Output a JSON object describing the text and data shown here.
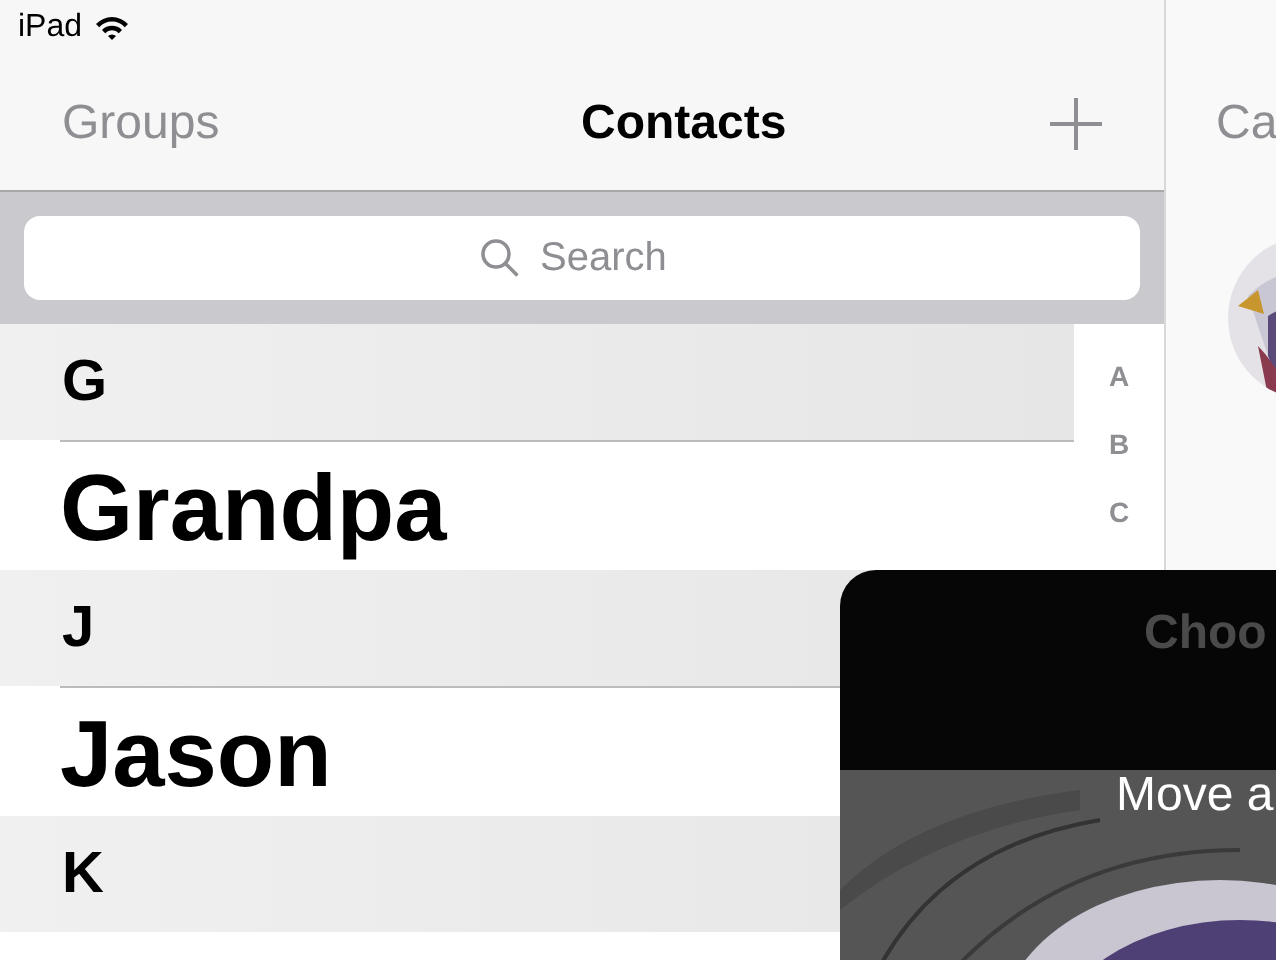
{
  "status_bar": {
    "device": "iPad"
  },
  "nav": {
    "left": "Groups",
    "title": "Contacts"
  },
  "search": {
    "placeholder": "Search"
  },
  "sections": [
    {
      "letter": "G",
      "contacts": [
        "Grandpa"
      ]
    },
    {
      "letter": "J",
      "contacts": [
        "Jason"
      ]
    },
    {
      "letter": "K"
    }
  ],
  "index": [
    "A",
    "B",
    "C"
  ],
  "detail": {
    "title": "Ca"
  },
  "overlay": {
    "title": "Choo",
    "hint": "Move a"
  }
}
